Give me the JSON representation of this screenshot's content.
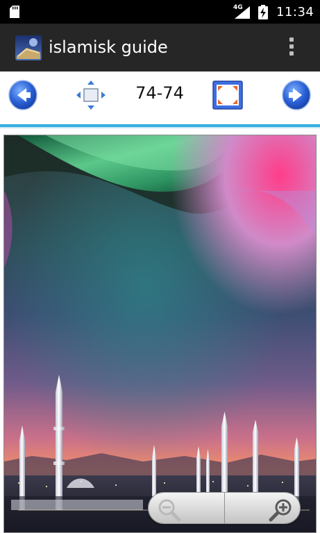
{
  "status_bar": {
    "network_type": "4G",
    "time": "11:34",
    "icons": [
      "sd-card-icon",
      "signal-icon",
      "battery-charging-icon"
    ]
  },
  "app_bar": {
    "title": "islamisk guide",
    "icons": [
      "app-logo-icon",
      "overflow-menu-icon"
    ]
  },
  "toolbar": {
    "page_indicator": "74-74",
    "icons": [
      "previous-page-icon",
      "fit-page-icon",
      "fullscreen-icon",
      "next-page-icon"
    ]
  },
  "viewer": {
    "content": "mosque-wallpaper-image"
  },
  "zoom_controls": {
    "icons": [
      "zoom-out-icon",
      "zoom-in-icon"
    ],
    "zoom_out_enabled": false
  },
  "colors": {
    "status_bar_bg": "#000000",
    "app_bar_bg": "#262626",
    "accent_divider": "#35aee0",
    "arrow_blue": "#2a5fd6"
  }
}
